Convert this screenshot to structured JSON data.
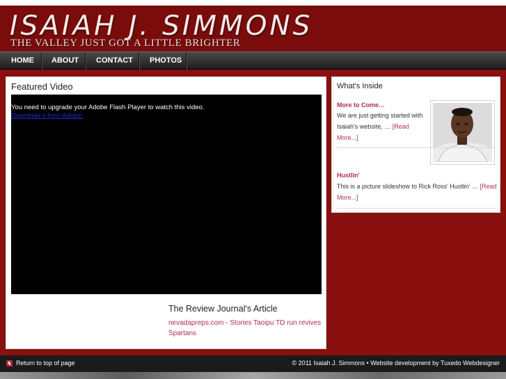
{
  "header": {
    "site_title": "ISAIAH J. SIMMONS",
    "tagline": "THE VALLEY JUST GOT A LITTLE BRIGHTER"
  },
  "nav": {
    "items": [
      {
        "label": "HOME"
      },
      {
        "label": "ABOUT"
      },
      {
        "label": "CONTACT"
      },
      {
        "label": "PHOTOS"
      }
    ]
  },
  "main": {
    "featured_title": "Featured Video",
    "flash_message": "You need to upgrade your Adobe Flash Player to watch this video.",
    "flash_link": "Download it from Adobe.",
    "article_title": "The Review Journal's Article",
    "article_link": "nevadapreps.com - Stories Taoipu TD run revives Spartans"
  },
  "sidebar": {
    "title": "What's Inside",
    "posts": [
      {
        "title": "More to Come…",
        "excerpt": "We are just getting started with Isaiah's website, … ",
        "more": "[Read More...]"
      },
      {
        "title": "Hustlin'",
        "excerpt": "This is a picture slideshow to Rick Ross' Hustlin' … ",
        "more": "[Read More...]"
      }
    ]
  },
  "footer": {
    "back_to_top": "Return to top of page",
    "credit": "© 2011 Isaiah J. Simmons • Website development by Tuxedo Webdesigner"
  },
  "colors": {
    "background": "#8a0f0f",
    "link": "#b02a5a",
    "nav_bar": "#2a2a2a",
    "footer": "#1b1b1b"
  }
}
